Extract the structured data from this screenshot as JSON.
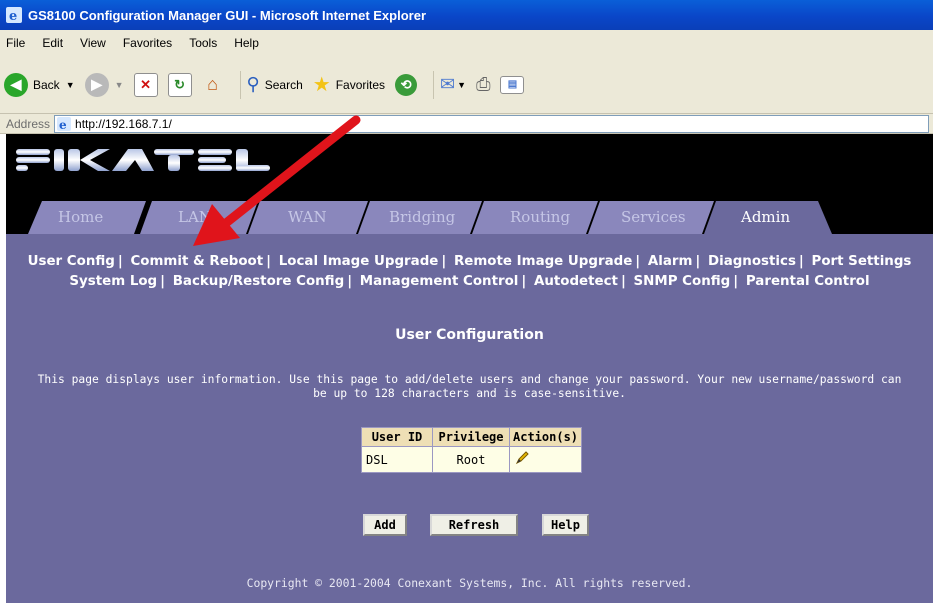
{
  "window": {
    "title": "GS8100 Configuration Manager GUI - Microsoft Internet Explorer"
  },
  "menu": [
    "File",
    "Edit",
    "View",
    "Favorites",
    "Tools",
    "Help"
  ],
  "toolbar": {
    "back": "Back",
    "search": "Search",
    "favorites": "Favorites"
  },
  "address": {
    "label": "Address",
    "url": "http://192.168.7.1/"
  },
  "tabs": [
    {
      "label": "Home"
    },
    {
      "label": "LAN"
    },
    {
      "label": "WAN"
    },
    {
      "label": "Bridging"
    },
    {
      "label": "Routing"
    },
    {
      "label": "Services"
    },
    {
      "label": "Admin"
    }
  ],
  "admin_links": {
    "row1": [
      "User Config",
      "Commit & Reboot",
      "Local Image Upgrade",
      "Remote Image Upgrade",
      "Alarm",
      "Diagnostics",
      "Port Settings"
    ],
    "row2": [
      "System Log",
      "Backup/Restore Config",
      "Management Control",
      "Autodetect",
      "SNMP Config",
      "Parental Control"
    ]
  },
  "page": {
    "title": "User Configuration",
    "description_line1": "This page displays user information. Use this page to add/delete users and change your password. Your new username/password can",
    "description_line2": "be up to 128 characters and is case-sensitive."
  },
  "user_table": {
    "headers": [
      "User ID",
      "Privilege",
      "Action(s)"
    ],
    "rows": [
      {
        "user_id": "DSL",
        "privilege": "Root",
        "action_icon": "pencil-edit-icon"
      }
    ]
  },
  "buttons": {
    "add": "Add",
    "refresh": "Refresh",
    "help": "Help"
  },
  "footer": {
    "copyright": "Copyright © 2001-2004 Conexant Systems, Inc. All rights reserved."
  },
  "colors": {
    "panel": "#6b699d",
    "tab": "#8a87bc",
    "arrow": "#e0141b"
  }
}
